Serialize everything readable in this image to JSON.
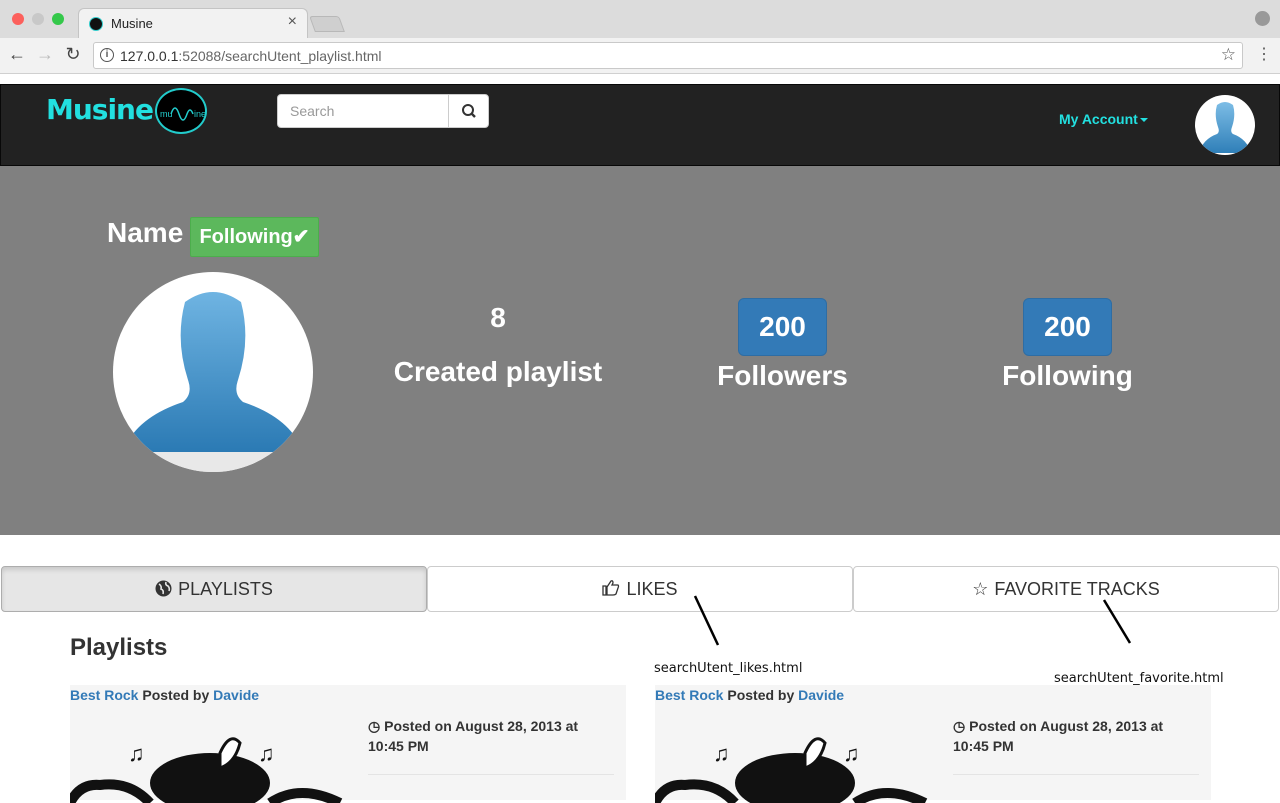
{
  "browser": {
    "tab_title": "Musine",
    "url_host": "127.0.0.1",
    "url_path": ":52088/searchUtent_playlist.html"
  },
  "navbar": {
    "brand": "Musine",
    "search_placeholder": "Search",
    "account_label": "My Account"
  },
  "profile": {
    "name": "Name",
    "follow_label": "Following",
    "created_playlists_count": "8",
    "created_playlists_label": "Created playlist",
    "followers_count": "200",
    "followers_label": "Followers",
    "following_count": "200",
    "following_label": "Following"
  },
  "tabs": {
    "playlists": "PLAYLISTS",
    "likes": "LIKES",
    "favorites": "FAVORITE TRACKS"
  },
  "annotations": {
    "likes": "searchUtent_likes.html",
    "favorites": "searchUtent_favorite.html"
  },
  "section_title": "Playlists",
  "playlists": [
    {
      "title": "Best Rock",
      "posted_by": "Posted by",
      "author": "Davide",
      "date": "Posted on August 28, 2013 at 10:45 PM"
    },
    {
      "title": "Best Rock",
      "posted_by": "Posted by",
      "author": "Davide",
      "date": "Posted on August 28, 2013 at 10:45 PM"
    }
  ],
  "colors": {
    "brand": "#22e0e0",
    "follow_green": "#5cb85c",
    "badge_blue": "#337ab7",
    "header_gray": "#808080"
  }
}
